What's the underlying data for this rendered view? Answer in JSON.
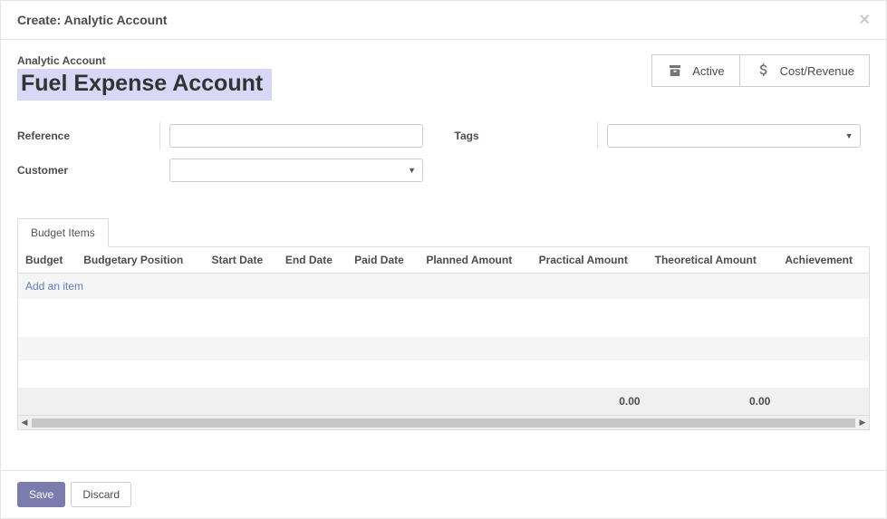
{
  "dialog": {
    "title": "Create: Analytic Account",
    "close": "×"
  },
  "account": {
    "label": "Analytic Account",
    "name": "Fuel Expense Account"
  },
  "stats": {
    "active": "Active",
    "cost_revenue": "Cost/Revenue"
  },
  "fields": {
    "reference_label": "Reference",
    "reference_value": "",
    "customer_label": "Customer",
    "customer_value": "",
    "tags_label": "Tags",
    "tags_value": ""
  },
  "tabs": {
    "budget_items": "Budget Items"
  },
  "table": {
    "headers": {
      "budget": "Budget",
      "budgetary_position": "Budgetary Position",
      "start_date": "Start Date",
      "end_date": "End Date",
      "paid_date": "Paid Date",
      "planned_amount": "Planned Amount",
      "practical_amount": "Practical Amount",
      "theoretical_amount": "Theoretical Amount",
      "achievement": "Achievement"
    },
    "add_item": "Add an item",
    "totals": {
      "practical": "0.00",
      "theoretical": "0.00"
    }
  },
  "footer": {
    "save": "Save",
    "discard": "Discard"
  }
}
